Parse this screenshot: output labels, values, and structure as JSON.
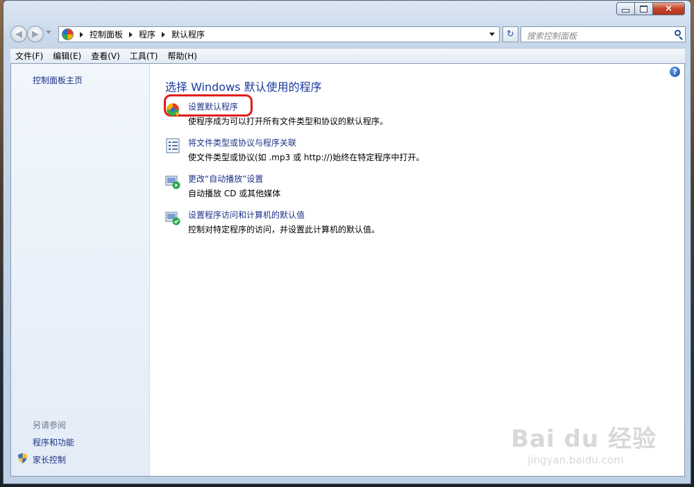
{
  "window": {
    "controls": {
      "minimize": "minimize",
      "maximize": "maximize",
      "close": "×"
    }
  },
  "navigation": {
    "back": "◀",
    "forward": "▶",
    "breadcrumb": [
      "控制面板",
      "程序",
      "默认程序"
    ],
    "search_placeholder": "搜索控制面板",
    "refresh": "↻"
  },
  "menu": [
    "文件(F)",
    "编辑(E)",
    "查看(V)",
    "工具(T)",
    "帮助(H)"
  ],
  "left_pane": {
    "home_link": "控制面板主页",
    "see_also_title": "另请参阅",
    "see_also": [
      "程序和功能",
      "家长控制"
    ]
  },
  "main": {
    "title": "选择 Windows 默认使用的程序",
    "help": "?",
    "tasks": [
      {
        "link": "设置默认程序",
        "desc": "使程序成为可以打开所有文件类型和协议的默认程序。",
        "icon": "default-programs-icon"
      },
      {
        "link": "将文件类型或协议与程序关联",
        "desc": "使文件类型或协议(如 .mp3 或 http://)始终在特定程序中打开。",
        "icon": "file-association-icon"
      },
      {
        "link": "更改“自动播放”设置",
        "desc": "自动播放 CD 或其他媒体",
        "icon": "autoplay-icon"
      },
      {
        "link": "设置程序访问和计算机的默认值",
        "desc": "控制对特定程序的访问，并设置此计算机的默认值。",
        "icon": "program-access-icon"
      }
    ]
  },
  "watermark": {
    "brand": "Bai du 经验",
    "url": "jingyan.baidu.com"
  },
  "colors": {
    "link": "#1e3287",
    "title": "#1a3aa0",
    "highlight": "#e21b1b"
  }
}
